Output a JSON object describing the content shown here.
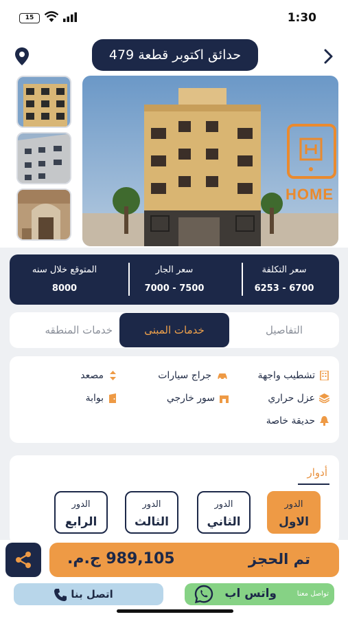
{
  "status_bar": {
    "time": "1:30",
    "battery": "15"
  },
  "header": {
    "title": "حدائق اكتوبر قطعة 479"
  },
  "gallery": {
    "thumbnail_count": 3,
    "logo_text": "HOME"
  },
  "prices": [
    {
      "label": "سعر التكلفة",
      "value": "6253 - 6700"
    },
    {
      "label": "سعر الجار",
      "value": "7000 - 7500"
    },
    {
      "label": "المتوقع خلال سنه",
      "value": "8000"
    }
  ],
  "tabs": [
    {
      "label": "التفاصيل",
      "active": false
    },
    {
      "label": "خدمات المبنى",
      "active": true
    },
    {
      "label": "خدمات المنطقه",
      "active": false
    }
  ],
  "services": [
    {
      "label": "تشطيب واجهة",
      "icon": "building-icon"
    },
    {
      "label": "جراج سيارات",
      "icon": "car-icon"
    },
    {
      "label": "مصعد",
      "icon": "elevator-icon"
    },
    {
      "label": "عزل حراري",
      "icon": "layers-icon"
    },
    {
      "label": "سور خارجي",
      "icon": "wall-icon"
    },
    {
      "label": "بوابة",
      "icon": "gate-icon"
    },
    {
      "label": "حديقة خاصة",
      "icon": "tree-icon"
    }
  ],
  "floors": {
    "title": "أدوار",
    "items": [
      {
        "line1": "الدور",
        "line2": "الاول",
        "active": true
      },
      {
        "line1": "الدور",
        "line2": "الثاني",
        "active": false
      },
      {
        "line1": "الدور",
        "line2": "الثالث",
        "active": false
      },
      {
        "line1": "الدور",
        "line2": "الرابع",
        "active": false
      }
    ]
  },
  "booking": {
    "price": "989,105 ج.م.",
    "status": "تم الحجز"
  },
  "contact": {
    "call_label": "اتصل بنا",
    "whatsapp_small": "تواصل معنا",
    "whatsapp_label": "واتس اب"
  },
  "colors": {
    "navy": "#1c2848",
    "orange": "#ee9a45",
    "call_bg": "#b8d6ea",
    "whatsapp_bg": "#86d285"
  }
}
